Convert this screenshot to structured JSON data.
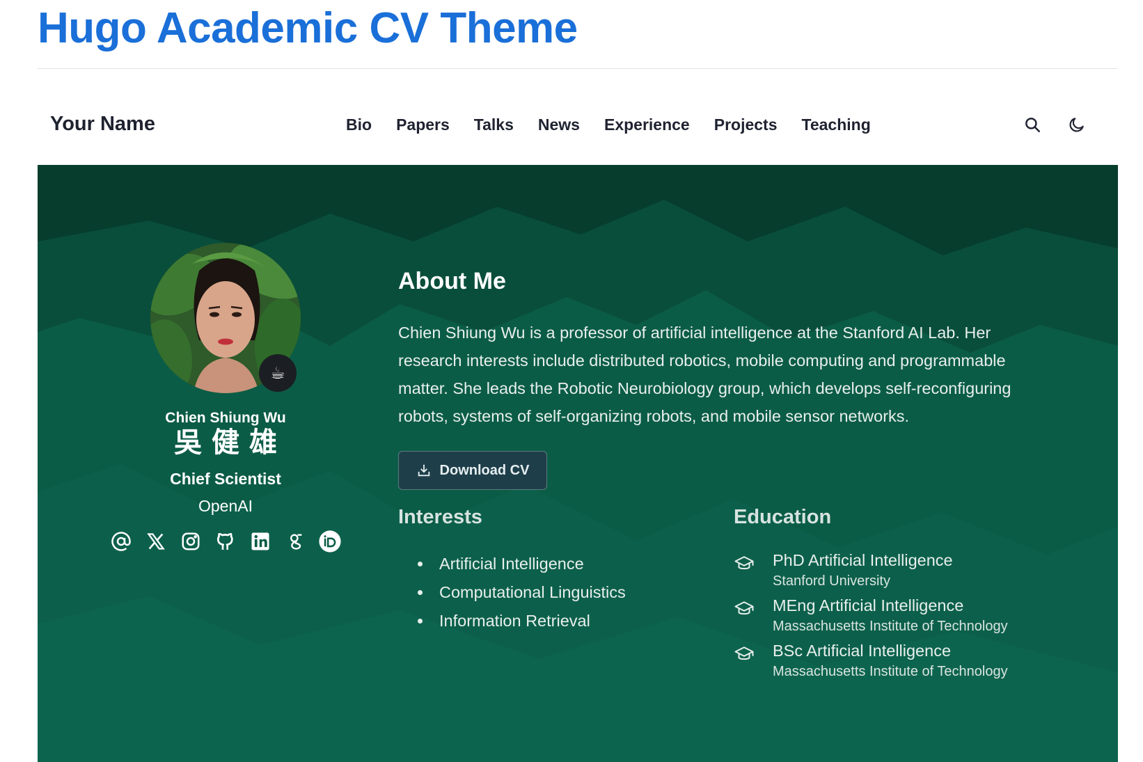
{
  "page": {
    "title": "Hugo Academic CV Theme"
  },
  "navbar": {
    "brand": "Your Name",
    "links": [
      "Bio",
      "Papers",
      "Talks",
      "News",
      "Experience",
      "Projects",
      "Teaching"
    ],
    "tools": [
      "search-icon",
      "moon-icon"
    ]
  },
  "profile": {
    "name_en": "Chien Shiung Wu",
    "name_zh": "吳健雄",
    "role": "Chief Scientist",
    "organization": "OpenAI",
    "status_emoji": "☕",
    "social_icons": [
      "email-icon",
      "x-icon",
      "instagram-icon",
      "github-icon",
      "linkedin-icon",
      "google-scholar-icon",
      "orcid-icon"
    ]
  },
  "about": {
    "heading": "About Me",
    "bio": "Chien Shiung Wu is a professor of artificial intelligence at the Stanford AI Lab. Her research interests include distributed robotics, mobile computing and programmable matter. She leads the Robotic Neurobiology group, which develops self-reconfiguring robots, systems of self-organizing robots, and mobile sensor networks.",
    "cv_button": "Download CV"
  },
  "interests": {
    "heading": "Interests",
    "items": [
      "Artificial Intelligence",
      "Computational Linguistics",
      "Information Retrieval"
    ]
  },
  "education": {
    "heading": "Education",
    "items": [
      {
        "degree": "PhD Artificial Intelligence",
        "school": "Stanford University"
      },
      {
        "degree": "MEng Artificial Intelligence",
        "school": "Massachusetts Institute of Technology"
      },
      {
        "degree": "BSc Artificial Intelligence",
        "school": "Massachusetts Institute of Technology"
      }
    ]
  },
  "colors": {
    "title_blue": "#1a6fd8",
    "hero_green": "#0b5c46",
    "button_bg": "#1e3f4a",
    "text_dark": "#1f2330"
  }
}
